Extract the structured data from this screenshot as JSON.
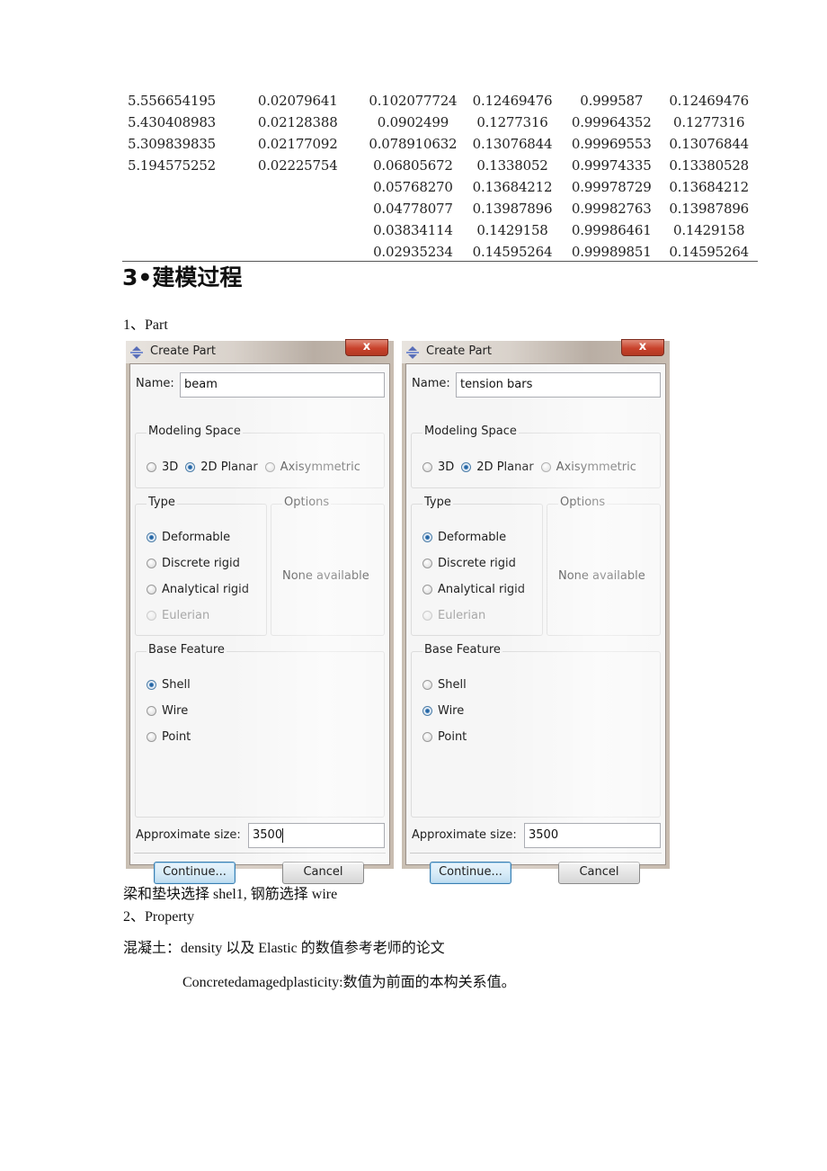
{
  "table": {
    "rows": [
      [
        "5.556654195",
        "0.02079641",
        "0.102077724",
        "0.12469476",
        "0.999587",
        "0.12469476"
      ],
      [
        "5.430408983",
        "0.02128388",
        "0.0902499",
        "0.1277316",
        "0.99964352",
        "0.1277316"
      ],
      [
        "5.309839835",
        "0.02177092",
        "0.078910632",
        "0.13076844",
        "0.99969553",
        "0.13076844"
      ],
      [
        "5.194575252",
        "0.02225754",
        "0.06805672",
        "0.1338052",
        "0.99974335",
        "0.13380528"
      ],
      [
        "",
        "",
        "0.05768270",
        "0.13684212",
        "0.99978729",
        "0.13684212"
      ],
      [
        "",
        "",
        "0.04778077",
        "0.13987896",
        "0.99982763",
        "0.13987896"
      ],
      [
        "",
        "",
        "0.03834114",
        "0.1429158",
        "0.99986461",
        "0.1429158"
      ],
      [
        "",
        "",
        "0.02935234",
        "0.14595264",
        "0.99989851",
        "0.14595264"
      ]
    ]
  },
  "section_heading": "3•建模过程",
  "step1_label": "1、Part",
  "dialogs": [
    {
      "title": "Create Part",
      "close_glyph": "x",
      "name_label": "Name:",
      "name_value": "beam",
      "modeling_space": {
        "title": "Modeling Space",
        "options": [
          "3D",
          "2D Planar",
          "Axisymmetric"
        ],
        "selected": "2D Planar"
      },
      "type": {
        "title": "Type",
        "options": [
          "Deformable",
          "Discrete rigid",
          "Analytical rigid",
          "Eulerian"
        ],
        "selected": "Deformable",
        "disabled": [
          "Eulerian"
        ]
      },
      "options_group": {
        "title": "Options",
        "text": "None available"
      },
      "base_feature": {
        "title": "Base Feature",
        "options": [
          "Shell",
          "Wire",
          "Point"
        ],
        "selected": "Shell"
      },
      "size_label": "Approximate size:",
      "size_value": "3500",
      "continue_label": "Continue...",
      "cancel_label": "Cancel"
    },
    {
      "title": "Create Part",
      "close_glyph": "x",
      "name_label": "Name:",
      "name_value": "tension bars",
      "modeling_space": {
        "title": "Modeling Space",
        "options": [
          "3D",
          "2D Planar",
          "Axisymmetric"
        ],
        "selected": "2D Planar"
      },
      "type": {
        "title": "Type",
        "options": [
          "Deformable",
          "Discrete rigid",
          "Analytical rigid",
          "Eulerian"
        ],
        "selected": "Deformable",
        "disabled": [
          "Eulerian"
        ]
      },
      "options_group": {
        "title": "Options",
        "text": "None available"
      },
      "base_feature": {
        "title": "Base Feature",
        "options": [
          "Shell",
          "Wire",
          "Point"
        ],
        "selected": "Wire"
      },
      "size_label": "Approximate size:",
      "size_value": "3500",
      "continue_label": "Continue...",
      "cancel_label": "Cancel"
    }
  ],
  "note_text": "梁和垫块选择 shel1, 钢筋选择 wire",
  "step2_label": "2、Property",
  "concrete_text": "混凝土：density 以及 Elastic 的数值参考老师的论文",
  "cdp_text": "Concretedamagedplasticity:数值为前面的本构关系值。"
}
